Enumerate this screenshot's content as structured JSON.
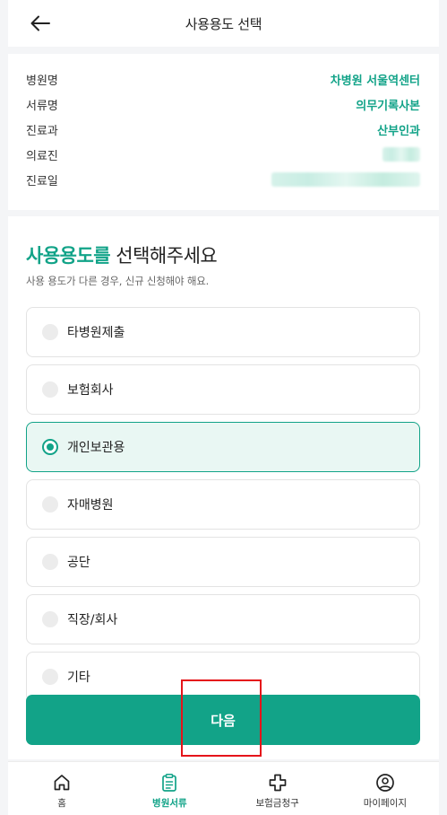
{
  "header": {
    "title": "사용용도 선택"
  },
  "info": {
    "rows": [
      {
        "label": "병원명",
        "value": "차병원 서울역센터"
      },
      {
        "label": "서류명",
        "value": "의무기록사본"
      },
      {
        "label": "진료과",
        "value": "산부인과"
      },
      {
        "label": "의료진",
        "value": ""
      },
      {
        "label": "진료일",
        "value": ""
      }
    ]
  },
  "selection": {
    "title_accent": "사용용도를",
    "title_rest": " 선택해주세요",
    "subtitle": "사용 용도가 다른 경우, 신규 신청해야 해요.",
    "options": [
      {
        "label": "타병원제출",
        "selected": false
      },
      {
        "label": "보험회사",
        "selected": false
      },
      {
        "label": "개인보관용",
        "selected": true
      },
      {
        "label": "자매병원",
        "selected": false
      },
      {
        "label": "공단",
        "selected": false
      },
      {
        "label": "직장/회사",
        "selected": false
      },
      {
        "label": "기타",
        "selected": false
      }
    ]
  },
  "next_button": {
    "label": "다음"
  },
  "nav": {
    "items": [
      {
        "label": "홈",
        "icon": "home-icon",
        "active": false
      },
      {
        "label": "병원서류",
        "icon": "clipboard-icon",
        "active": true
      },
      {
        "label": "보험금청구",
        "icon": "plus-cross-icon",
        "active": false
      },
      {
        "label": "마이페이지",
        "icon": "user-circle-icon",
        "active": false
      }
    ]
  },
  "colors": {
    "accent": "#12a388",
    "highlight": "#e5141a"
  }
}
